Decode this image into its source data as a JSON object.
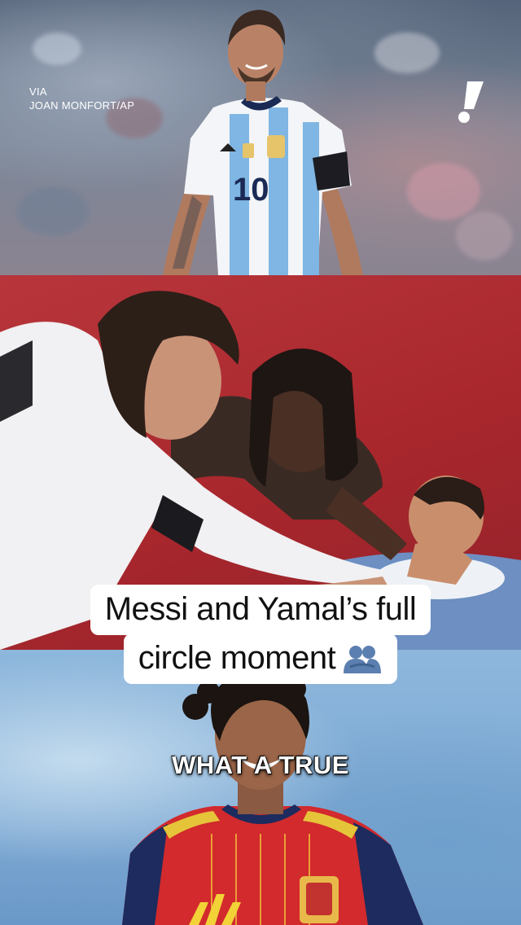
{
  "credit": {
    "line1": "VIA",
    "line2": "JOAN MONFORT/AP"
  },
  "brand": {
    "icon": "exclamation-logo-icon",
    "color": "#ffffff"
  },
  "top_panel": {
    "jersey_number": "10"
  },
  "caption": {
    "line1": "Messi and Yamal’s full",
    "line2": "circle moment",
    "emoji_icon": "people-hugging-icon"
  },
  "subtitle": "WHAT A TRUE",
  "colors": {
    "mid_backdrop": "#a8272d",
    "bottom_backdrop": "#7faad4",
    "caption_bg": "#ffffff",
    "caption_text": "#111111"
  }
}
